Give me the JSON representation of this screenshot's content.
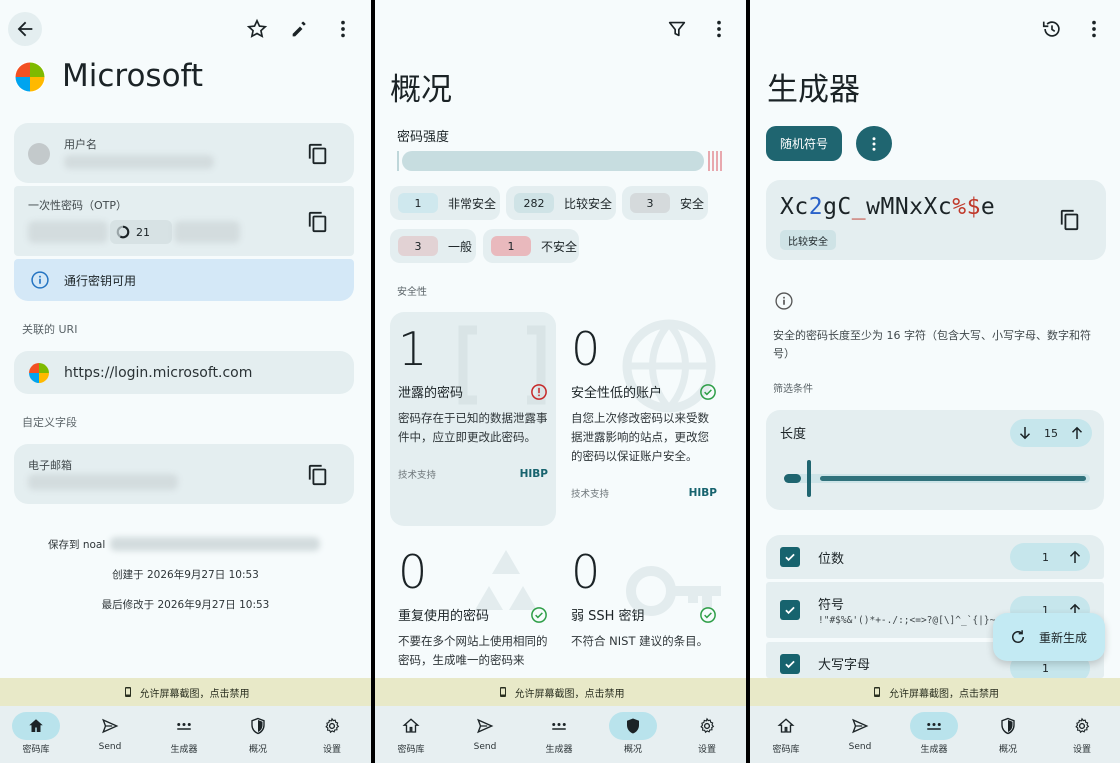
{
  "vault": {
    "item_title": "Microsoft",
    "username_label": "用户名",
    "otp_label": "一次性密码（OTP）",
    "otp_timer": "21",
    "passkey_text": "通行密钥可用",
    "uri_section": "关联的 URI",
    "uri_value": "https://login.microsoft.com",
    "custom_section": "自定义字段",
    "email_label": "电子邮箱",
    "saved_to": "保存到 noal",
    "created": "创建于 2026年9月27日 10:53",
    "modified": "最后修改于 2026年9月27日 10:53"
  },
  "overview": {
    "title": "概况",
    "strength_label": "密码强度",
    "chips": [
      {
        "count": "1",
        "label": "非常安全",
        "color": "#cfe8ee"
      },
      {
        "count": "282",
        "label": "比较安全",
        "color": "#cfe3e6"
      },
      {
        "count": "3",
        "label": "安全",
        "color": "#d5dadc"
      },
      {
        "count": "3",
        "label": "一般",
        "color": "#e2d2d4"
      },
      {
        "count": "1",
        "label": "不安全",
        "color": "#e9b9bd"
      }
    ],
    "security_label": "安全性",
    "stats": [
      {
        "value": "1",
        "title": "泄露的密码",
        "desc": "密码存在于已知的数据泄露事件中，应立即更改此密码。",
        "powered": "技术支持",
        "provider": "HIBP"
      },
      {
        "value": "0",
        "title": "安全性低的账户",
        "desc": "自您上次修改密码以来受数据泄露影响的站点，更改您的密码以保证账户安全。",
        "powered": "技术支持",
        "provider": "HIBP"
      },
      {
        "value": "0",
        "title": "重复使用的密码",
        "desc": "不要在多个网站上使用相同的密码，生成唯一的密码来"
      },
      {
        "value": "0",
        "title": "弱 SSH 密钥",
        "desc": "不符合 NIST 建议的条目。"
      }
    ]
  },
  "generator": {
    "title": "生成器",
    "mode_button": "随机符号",
    "password_parts": [
      {
        "t": "Xc",
        "c": "#1b2326"
      },
      {
        "t": "2",
        "c": "#2a62c9"
      },
      {
        "t": "gC",
        "c": "#1b2326"
      },
      {
        "t": "_",
        "c": "#c0392b"
      },
      {
        "t": "wMNxXc",
        "c": "#1b2326"
      },
      {
        "t": "%$",
        "c": "#c0392b"
      },
      {
        "t": "e",
        "c": "#1b2326"
      }
    ],
    "strength_badge": "比较安全",
    "hint": "安全的密码长度至少为 16 字符（包含大写、小写字母、数字和符号）",
    "filter_label": "筛选条件",
    "length_label": "长度",
    "length_value": "15",
    "length_fraction": 0.03,
    "digits_label": "位数",
    "digits_value": "1",
    "symbols_label": "符号",
    "symbols_chars": "!\"#$%&'()*+-./:;<=>?@[\\]^_`{|}~",
    "symbols_value": "1",
    "upper_label": "大写字母",
    "upper_value": "1",
    "regen_button": "重新生成"
  },
  "banner_text": "允许屏幕截图，点击禁用",
  "nav": [
    "密码库",
    "Send",
    "生成器",
    "概况",
    "设置"
  ]
}
